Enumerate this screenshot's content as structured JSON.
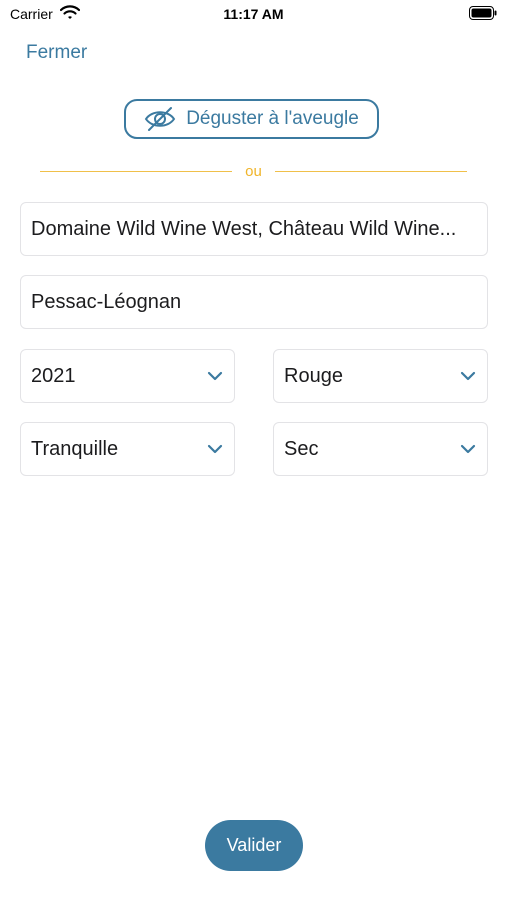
{
  "status_bar": {
    "carrier": "Carrier",
    "time": "11:17 AM"
  },
  "header": {
    "close_label": "Fermer"
  },
  "blind_tasting": {
    "label": "Déguster à l'aveugle",
    "icon": "eye-slash-icon"
  },
  "divider": {
    "label": "ou"
  },
  "form": {
    "producer": "Domaine Wild Wine West, Château Wild Wine...",
    "appellation": "Pessac-Léognan",
    "vintage": "2021",
    "color": "Rouge",
    "type": "Tranquille",
    "sweetness": "Sec"
  },
  "actions": {
    "submit_label": "Valider"
  },
  "colors": {
    "accent": "#3b7aa0",
    "divider": "#f0c04a",
    "border": "#e3e3e6"
  }
}
